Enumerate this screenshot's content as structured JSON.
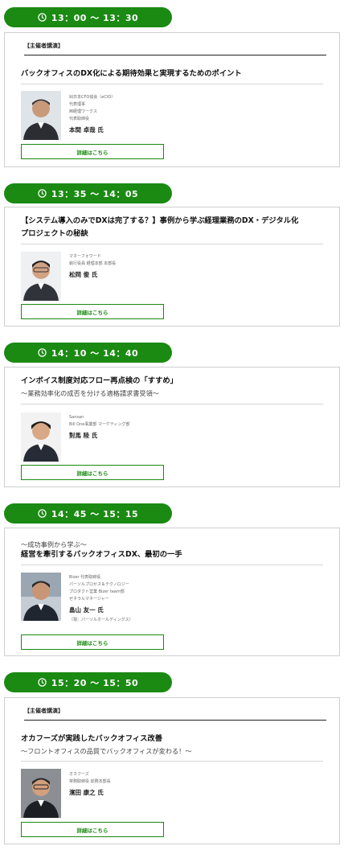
{
  "sessions": [
    {
      "time": "13：00 ～ 13：30",
      "tag": "【主催者講演】",
      "title_lines": [
        "バックオフィスのDX化による期待効果と実現するためのポイント"
      ],
      "subtitle": "",
      "org_lines": [
        "㈳日本CFO協会（eCIO）",
        "代表理事",
        "㈱経理ワークス",
        "代表取締役"
      ],
      "name": "本間 卓哉 氏",
      "note": "",
      "button": "詳細はこちら"
    },
    {
      "time": "13：35 ～ 14：05",
      "tag": "",
      "title_lines": [
        "【システム導入のみでDXは完了する？】事例から学ぶ経理業務のDX・デジタル化",
        "プロジェクトの秘訣"
      ],
      "subtitle": "",
      "org_lines": [
        "マネーフォワード",
        "執行役員 経理本部 本部長"
      ],
      "name": "松岡 俊 氏",
      "note": "",
      "button": "詳細はこちら"
    },
    {
      "time": "14：10 ～ 14：40",
      "tag": "",
      "title_lines": [
        "インボイス制度対応フロー再点検の「すすめ」"
      ],
      "subtitle": "～業務効率化の成否を分ける適格請求書受領～",
      "org_lines": [
        "Sansan",
        "Bill One事業部 マーケティング部"
      ],
      "name": "對馬 陸 氏",
      "note": "",
      "button": "詳細はこちら"
    },
    {
      "time": "14：45 ～ 15：15",
      "tag": "",
      "pre_title": "～成功事例から学ぶ～",
      "title_lines": [
        "経営を牽引するバックオフィスDX、最初の一手"
      ],
      "subtitle": "",
      "org_lines": [
        "Bizer 代表取締役",
        "パーソルプロセス＆テクノロジー",
        "プロダクト営業 Bizer team部",
        "ゼネラルマネージャー"
      ],
      "name": "畠山 友一 氏",
      "note": "（現：パーソルホールディングス）",
      "button": "詳細はこちら"
    },
    {
      "time": "15：20 ～ 15：50",
      "tag": "【主催者講演】",
      "title_lines": [
        "オカフーズが実践したバックオフィス改善"
      ],
      "subtitle": "～フロントオフィスの品質でバックオフィスが変わる！～",
      "org_lines": [
        "オカフーズ",
        "常務取締役 総務本部長"
      ],
      "name": "濱田 康之 氏",
      "note": "",
      "button": "詳細はこちら"
    }
  ],
  "colors": {
    "accent": "#1a8a12",
    "border": "#cfcfcf"
  },
  "icons": {
    "time": "clock-icon"
  }
}
